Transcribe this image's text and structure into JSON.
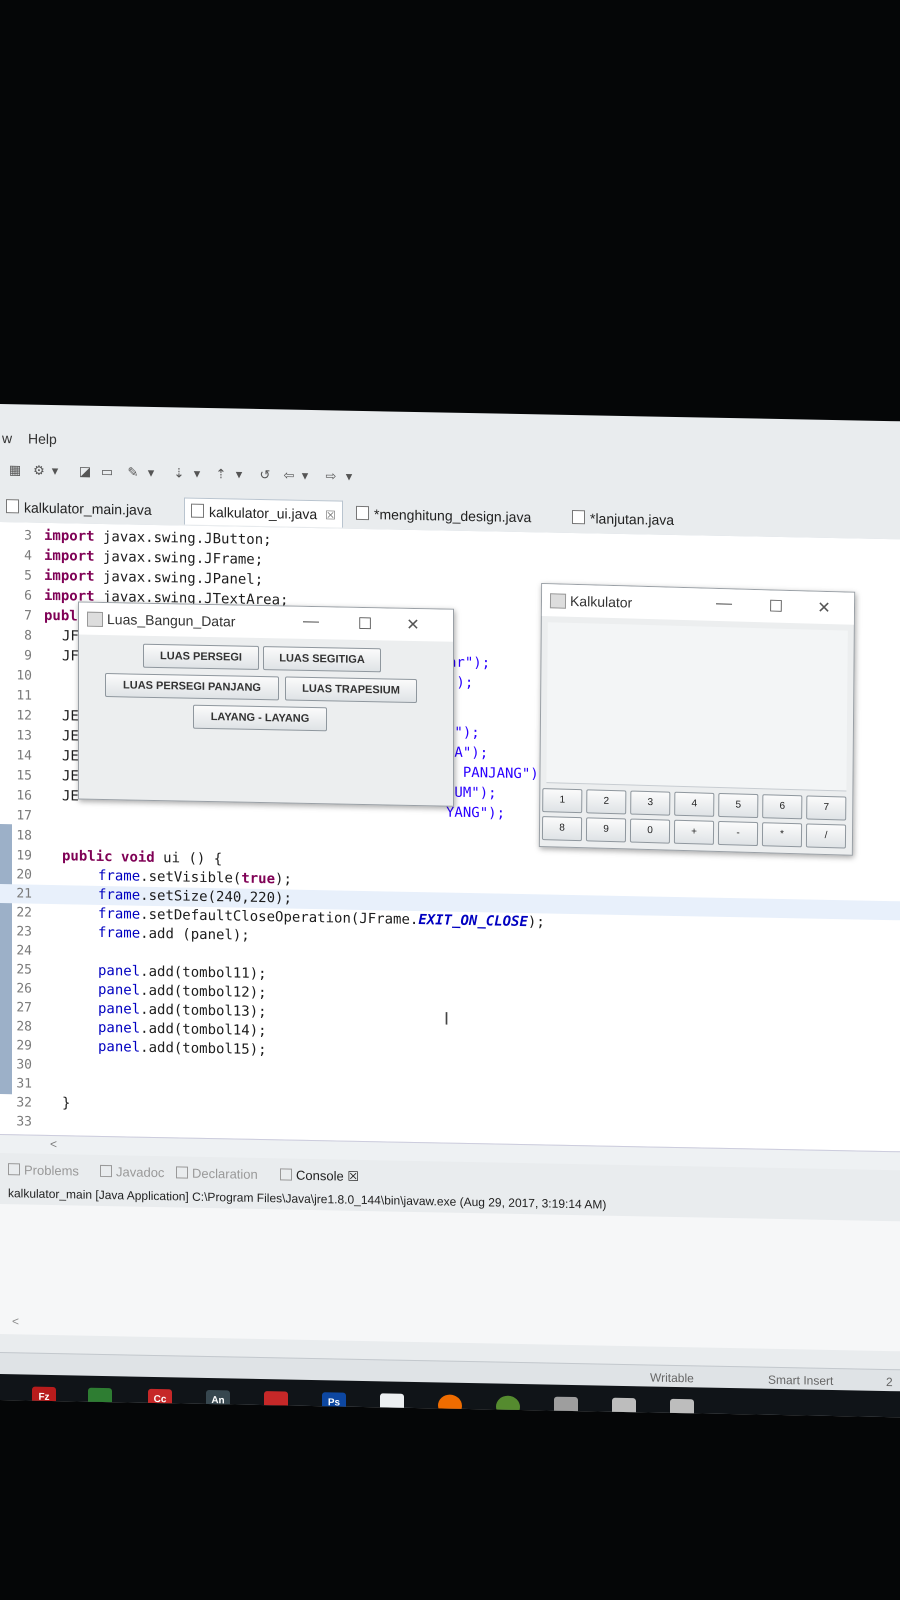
{
  "menubar": {
    "partial": "w",
    "help": "Help"
  },
  "toolbar": {
    "icons": [
      "new-icon",
      "debug-icon",
      "dropdown-arrow-icon",
      "package-icon",
      "folder-icon",
      "tool-icon",
      "dropdown-arrow-icon",
      "next-annotation-icon",
      "dropdown-arrow-icon",
      "prev-annotation-icon",
      "dropdown-arrow-icon",
      "last-edit-icon",
      "back-icon",
      "dropdown-arrow-icon",
      "forward-icon",
      "dropdown-arrow-icon"
    ]
  },
  "editor_tabs": [
    {
      "label": "kalkulator_main.java",
      "active": false
    },
    {
      "label": "kalkulator_ui.java",
      "active": true,
      "close": "☒"
    },
    {
      "label": "*menghitung_design.java",
      "active": false
    },
    {
      "label": "*lanjutan.java",
      "active": false
    }
  ],
  "code_lines": [
    {
      "n": "3",
      "kw": "import",
      "rest": " javax.swing.JButton;"
    },
    {
      "n": "4",
      "kw": "import",
      "rest": " javax.swing.JFrame;"
    },
    {
      "n": "5",
      "kw": "import",
      "rest": " javax.swing.JPanel;"
    },
    {
      "n": "6",
      "kw": "import",
      "rest": " javax.swing.JTextArea;"
    },
    {
      "n": "7",
      "kw": "publ",
      "rest": ""
    },
    {
      "n": "8",
      "kw": "",
      "rest": "JF"
    },
    {
      "n": "9",
      "kw": "",
      "rest": "JF"
    },
    {
      "n": "10",
      "kw": "",
      "rest": ""
    },
    {
      "n": "11",
      "kw": "",
      "rest": ""
    },
    {
      "n": "12",
      "kw": "",
      "rest": "JE"
    },
    {
      "n": "13",
      "kw": "",
      "rest": "JE"
    },
    {
      "n": "14",
      "kw": "",
      "rest": "JE"
    },
    {
      "n": "15",
      "kw": "",
      "rest": "JE"
    },
    {
      "n": "16",
      "kw": "",
      "rest": "JE"
    },
    {
      "n": "17",
      "kw": "",
      "rest": ""
    },
    {
      "n": "18",
      "kw": "",
      "rest": ""
    }
  ],
  "right_fragments": [
    "ar\");",
    "));",
    "I\");",
    "GA\");",
    "I PANJANG\")",
    "IUM\");",
    "YANG\");"
  ],
  "method": {
    "n19": "19",
    "n20": "20",
    "n21": "21",
    "n22": "22",
    "n23": "23",
    "n24": "24",
    "n25": "25",
    "n26": "26",
    "n27": "27",
    "n28": "28",
    "n29": "29",
    "n30": "30",
    "n31": "31",
    "n32": "32",
    "n33": "33",
    "kw_public": "public",
    "kw_void": "void",
    "sig": " ui () {",
    "l20_a": "frame",
    "l20_b": ".setVisible(",
    "l20_kw": "true",
    "l20_c": ");",
    "l21_a": "frame",
    "l21_b": ".setSize(240,220);",
    "l22_a": "frame",
    "l22_b": ".setDefaultCloseOperation(JFrame.",
    "l22_const": "EXIT_ON_CLOSE",
    "l22_c": ");",
    "l23_a": "frame",
    "l23_b": ".add (panel);",
    "l25_a": "panel",
    "l25_b": ".add(tombol11);",
    "l26_a": "panel",
    "l26_b": ".add(tombol12);",
    "l27_a": "panel",
    "l27_b": ".add(tombol13);",
    "l28_a": "panel",
    "l28_b": ".add(tombol14);",
    "l29_a": "panel",
    "l29_b": ".add(tombol15);",
    "close_brace": "}"
  },
  "luas_window": {
    "title": "Luas_Bangun_Datar",
    "buttons": [
      "LUAS PERSEGI",
      "LUAS SEGITIGA",
      "LUAS PERSEGI PANJANG",
      "LUAS TRAPESIUM",
      "LAYANG - LAYANG"
    ]
  },
  "kalkulator_window": {
    "title": "Kalkulator",
    "row1": [
      "1",
      "2",
      "3",
      "4",
      "5",
      "6",
      "7"
    ],
    "row2": [
      "8",
      "9",
      "0",
      "+",
      "-",
      "*",
      "/"
    ]
  },
  "window_controls": {
    "minimize": "—",
    "maximize": "☐",
    "close": "✕"
  },
  "hscroll_arrow": "<",
  "views": [
    {
      "label": "Problems",
      "active": false
    },
    {
      "label": "Javadoc",
      "active": false
    },
    {
      "label": "Declaration",
      "active": false
    },
    {
      "label": "Console",
      "active": true,
      "close": "☒"
    }
  ],
  "console_header": "kalkulator_main [Java Application] C:\\Program Files\\Java\\jre1.8.0_144\\bin\\javaw.exe (Aug 29, 2017, 3:19:14 AM)",
  "console_scroll_arrow": "<",
  "status": {
    "writable": "Writable",
    "insert": "Smart Insert",
    "pos": "2"
  },
  "taskbar_apps": [
    {
      "icon": "filezilla-icon",
      "label": "Fz",
      "color": "#b71c1c"
    },
    {
      "icon": "mobile-app-icon",
      "label": "",
      "color": "#2e7d32"
    },
    {
      "icon": "creative-cloud-icon",
      "label": "Cc",
      "color": "#c62828"
    },
    {
      "icon": "animate-icon",
      "label": "An",
      "color": "#37474f"
    },
    {
      "icon": "media-icon",
      "label": "",
      "color": "#c62828"
    },
    {
      "icon": "photoshop-icon",
      "label": "Ps",
      "color": "#0d47a1"
    },
    {
      "icon": "notepad-icon",
      "label": "",
      "color": "#eceff1"
    },
    {
      "icon": "firefox-icon",
      "label": "",
      "color": "#ef6c00"
    },
    {
      "icon": "android-icon",
      "label": "",
      "color": "#558b2f"
    },
    {
      "icon": "terminal-icon",
      "label": "",
      "color": "#9e9e9e"
    },
    {
      "icon": "java-app-icon",
      "label": "",
      "color": "#bdbdbd"
    },
    {
      "icon": "java-app-icon",
      "label": "",
      "color": "#bdbdbd"
    }
  ]
}
